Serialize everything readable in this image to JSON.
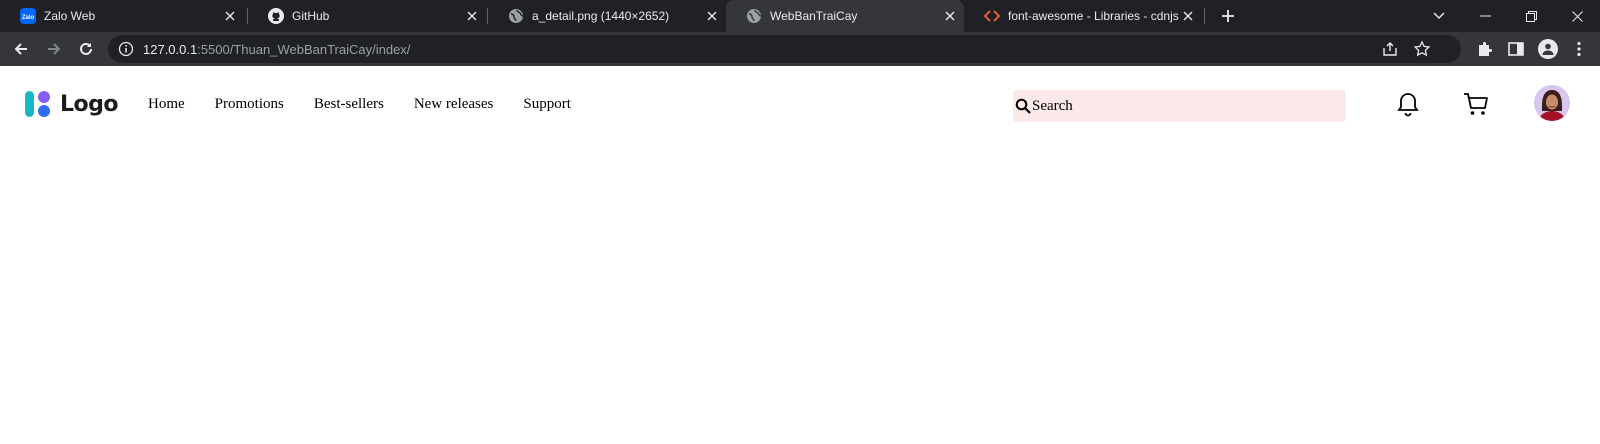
{
  "browser": {
    "tabs": [
      {
        "title": "Zalo Web",
        "icon": "zalo-icon",
        "active": false
      },
      {
        "title": "GitHub",
        "icon": "github-icon",
        "active": false
      },
      {
        "title": "a_detail.png (1440×2652)",
        "icon": "globe-icon",
        "active": false
      },
      {
        "title": "WebBanTraiCay",
        "icon": "globe-icon",
        "active": true
      },
      {
        "title": "font-awesome - Libraries - cdnjs",
        "icon": "code-icon",
        "active": false
      }
    ],
    "address": {
      "host": "127.0.0.1",
      "path": ":5500/Thuan_WebBanTraiCay/index/"
    }
  },
  "site": {
    "logo_text": "Logo",
    "nav": [
      "Home",
      "Promotions",
      "Best-sellers",
      "New releases",
      "Support"
    ],
    "search": {
      "placeholder": "Search"
    }
  },
  "colors": {
    "logo_teal": "#18b7c8",
    "logo_purple": "#8a5cf5",
    "logo_blue": "#2f6df6",
    "search_bg": "#fbe9e9",
    "chrome_dark": "#202124",
    "chrome_toolbar": "#35363a"
  }
}
